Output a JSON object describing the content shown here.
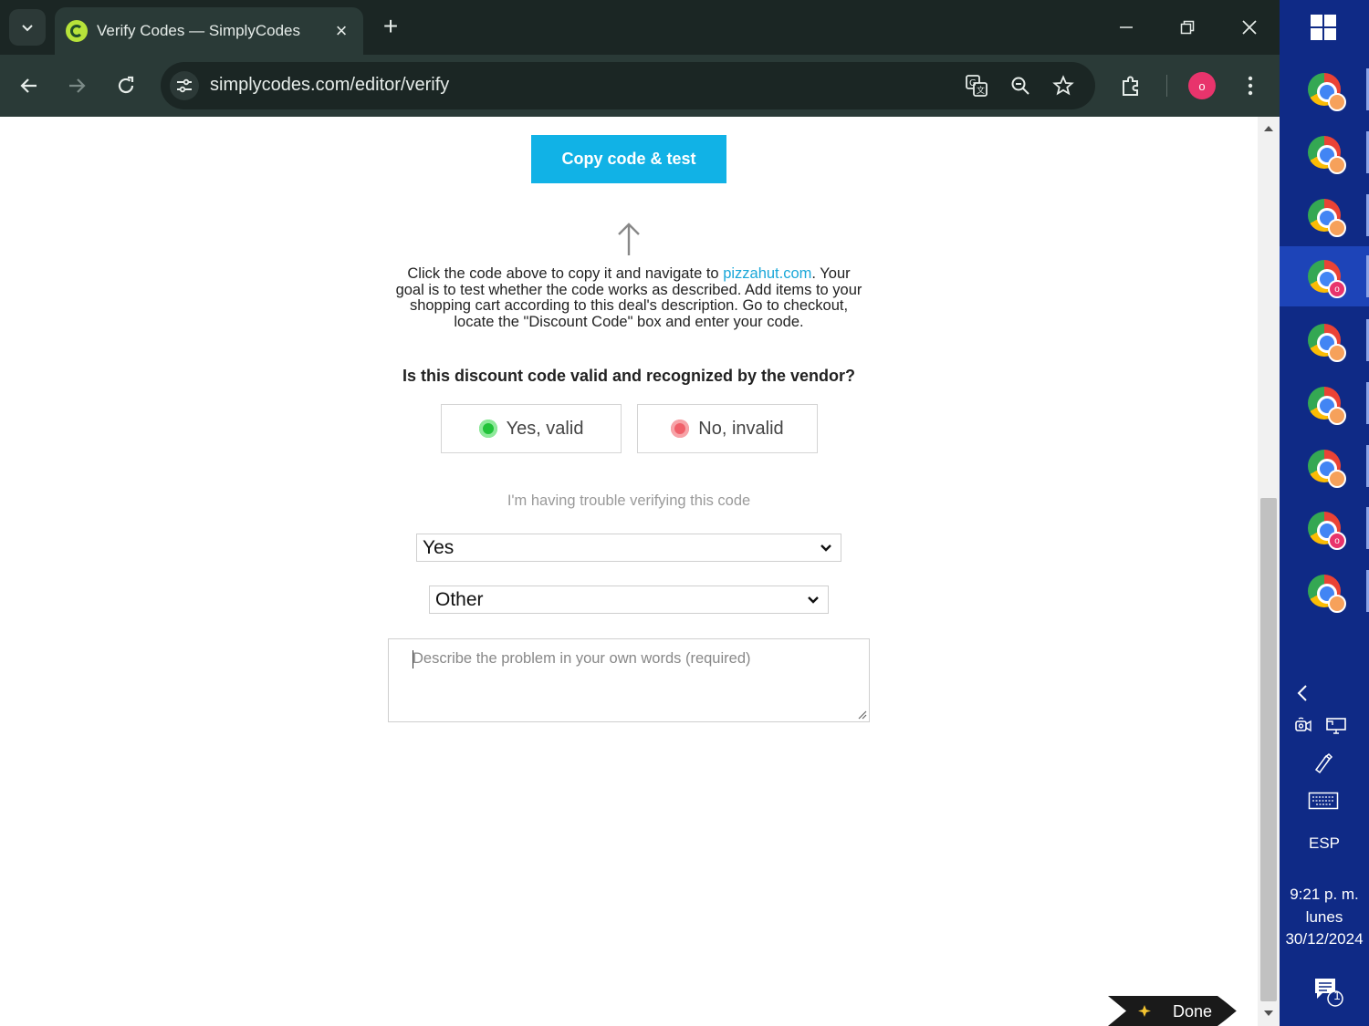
{
  "browser": {
    "tab_title": "Verify Codes — SimplyCodes",
    "url": "simplycodes.com/editor/verify",
    "profile_initial": "o"
  },
  "page": {
    "copy_button_label": "Copy code & test",
    "instructions_before_link": "Click the code above to copy it and navigate to ",
    "vendor_link": "pizzahut.com",
    "instructions_after_link": ". Your goal is to test whether the code works as described. Add items to your shopping cart according to this deal's description. Go to checkout, locate the \"Discount Code\" box and enter your code.",
    "question": "Is this discount code valid and recognized by the vendor?",
    "choice_valid": "Yes, valid",
    "choice_invalid": "No, invalid",
    "trouble_text": "I'm having trouble verifying this code",
    "trouble_select_value": "Yes",
    "reason_select_value": "Other",
    "description_placeholder": "Describe the problem in your own words (required)",
    "done_label": "Done"
  },
  "colors": {
    "copy_button": "#11b2e6",
    "valid_dot": "#22c33a",
    "invalid_dot": "#f0606a",
    "link": "#1aa7d8",
    "taskbar": "#0f2a86"
  },
  "taskbar": {
    "apps": [
      {
        "icon": "chrome-icon",
        "badge": ""
      },
      {
        "icon": "chrome-icon",
        "badge": ""
      },
      {
        "icon": "chrome-icon",
        "badge": ""
      },
      {
        "icon": "chrome-icon",
        "badge": "o",
        "active": true
      },
      {
        "icon": "chrome-icon",
        "badge": ""
      },
      {
        "icon": "chrome-icon",
        "badge": ""
      },
      {
        "icon": "chrome-icon",
        "badge": ""
      },
      {
        "icon": "chrome-icon",
        "badge": "o"
      },
      {
        "icon": "chrome-icon",
        "badge": ""
      }
    ],
    "language": "ESP",
    "time": "9:21 p. m.",
    "day": "lunes",
    "date": "30/12/2024",
    "notification_count": "1"
  }
}
